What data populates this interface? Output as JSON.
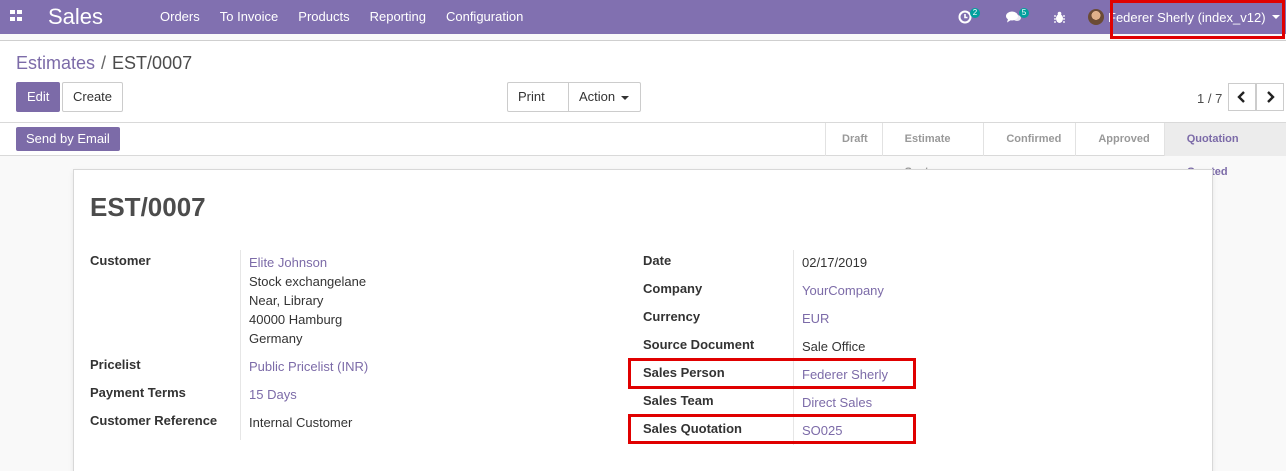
{
  "navbar": {
    "app_title": "Sales",
    "menu": [
      "Orders",
      "To Invoice",
      "Products",
      "Reporting",
      "Configuration"
    ],
    "activity_count": "2",
    "messages_count": "5",
    "user_name": "Federer Sherly (index_v12)"
  },
  "breadcrumb": {
    "parent": "Estimates",
    "separator": "/",
    "current": "EST/0007"
  },
  "buttons": {
    "edit": "Edit",
    "create": "Create",
    "print": "Print",
    "action": "Action",
    "send_by_email": "Send by Email"
  },
  "pager": {
    "value": "1 / 7",
    "prev": "‹",
    "next": "›"
  },
  "stages": [
    "Draft",
    "Estimate Sent",
    "Confirmed",
    "Approved",
    "Quotation Created"
  ],
  "active_stage": "Quotation Created",
  "record": {
    "name": "EST/0007",
    "left": {
      "customer_label": "Customer",
      "customer_name": "Elite Johnson",
      "customer_address": [
        "Stock exchangelane",
        "Near, Library",
        "40000 Hamburg",
        "Germany"
      ],
      "pricelist_label": "Pricelist",
      "pricelist": "Public Pricelist (INR)",
      "payment_terms_label": "Payment Terms",
      "payment_terms": "15 Days",
      "customer_reference_label": "Customer Reference",
      "customer_reference": "Internal Customer"
    },
    "right": {
      "date_label": "Date",
      "date": "02/17/2019",
      "company_label": "Company",
      "company": "YourCompany",
      "currency_label": "Currency",
      "currency": "EUR",
      "source_document_label": "Source Document",
      "source_document": "Sale Office",
      "sales_person_label": "Sales Person",
      "sales_person": "Federer Sherly",
      "sales_team_label": "Sales Team",
      "sales_team": "Direct Sales",
      "sales_quotation_label": "Sales Quotation",
      "sales_quotation": "SO025"
    }
  },
  "colors": {
    "brand": "#8170b0",
    "link": "#7c6ba8",
    "badge": "#00a09d",
    "highlight": "#e00000"
  }
}
